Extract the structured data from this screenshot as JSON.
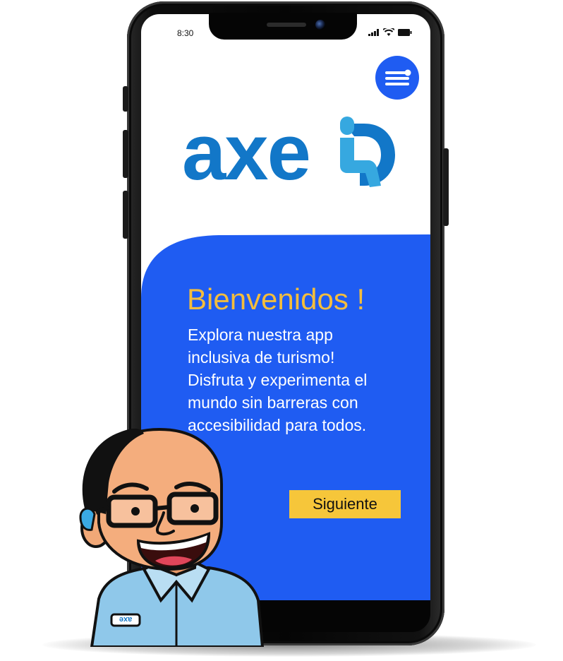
{
  "status_bar": {
    "time": "8:30",
    "icons": [
      "signal-icon",
      "wifi-icon",
      "battery-icon"
    ]
  },
  "header": {
    "menu_icon": "menu-icon"
  },
  "logo": {
    "text": "axe",
    "icon": "wheelchair-icon"
  },
  "welcome": {
    "title": "Bienvenidos !",
    "body_lines": [
      "Explora nuestra app",
      "inclusiva de turismo!",
      "Disfruta y experimenta el",
      "mundo sin barreras  con",
      "accesibilidad para todos."
    ],
    "next_label": "Siguiente"
  },
  "mascot": {
    "badge_text": "axe"
  },
  "colors": {
    "primary_blue": "#1f5cf2",
    "logo_blue": "#1277c8",
    "logo_light_blue": "#36a8e0",
    "accent_yellow": "#f3bd3d",
    "button_yellow": "#f6c63a",
    "phone_black": "#050505"
  }
}
